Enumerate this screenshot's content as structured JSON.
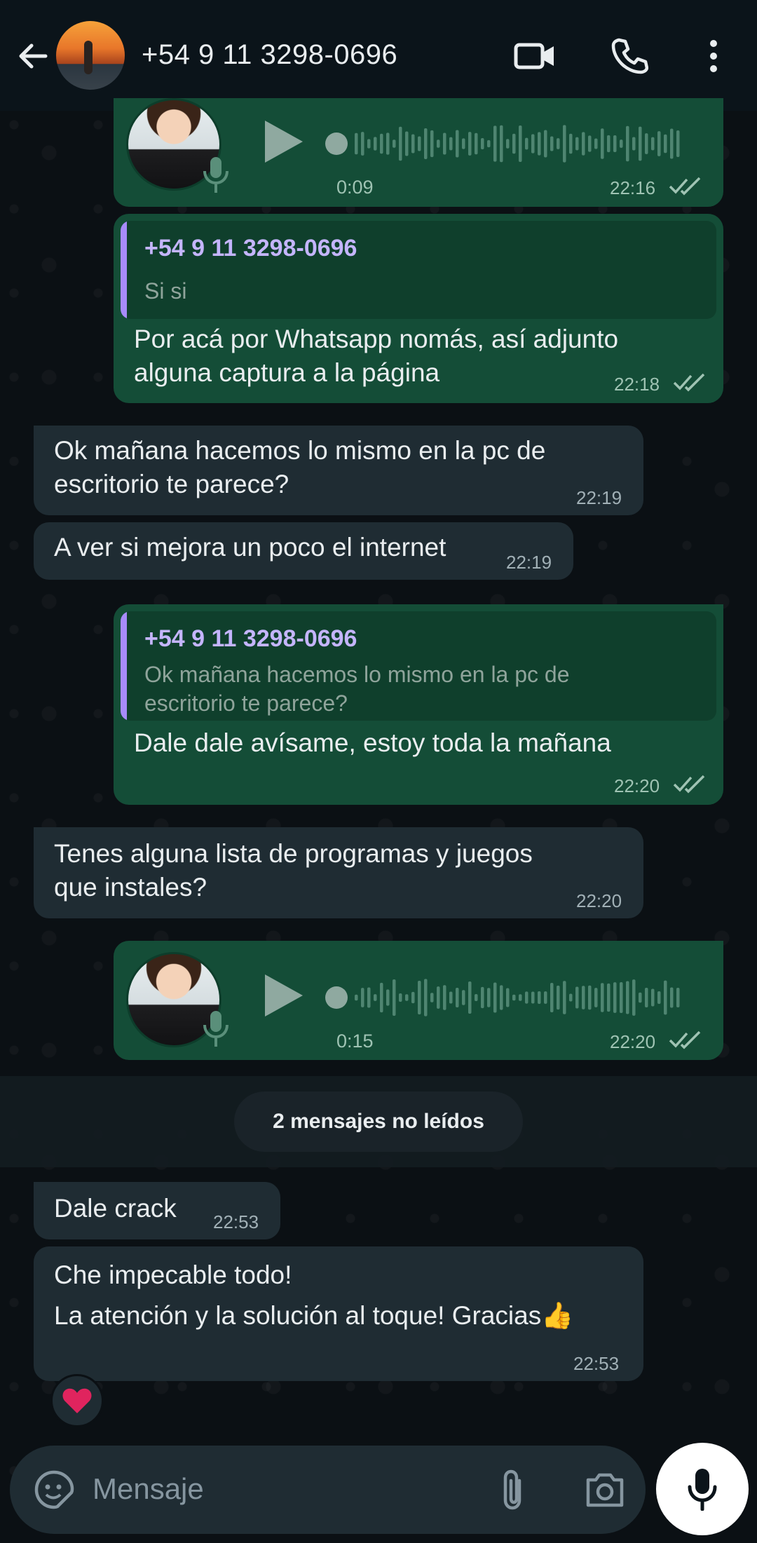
{
  "header": {
    "contact_name": "+54 9 11 3298-0696",
    "icons": [
      "back-arrow-icon",
      "video-call-icon",
      "phone-icon",
      "more-options-icon"
    ]
  },
  "messages": [
    {
      "type": "voice",
      "direction": "out",
      "duration": "0:09",
      "time": "22:16",
      "status": "read"
    },
    {
      "type": "text",
      "direction": "out",
      "quote_author": "+54 9 11 3298-0696",
      "quote_text": "Si si",
      "text": "Por acá por Whatsapp nomás, así adjunto\nalguna captura a la página",
      "time": "22:18",
      "status": "read"
    },
    {
      "type": "text",
      "direction": "in",
      "text": "Ok mañana hacemos lo mismo en la pc de\nescritorio te parece?",
      "time": "22:19"
    },
    {
      "type": "text",
      "direction": "in",
      "text": "A ver si mejora un poco el internet",
      "time": "22:19"
    },
    {
      "type": "text",
      "direction": "out",
      "quote_author": "+54 9 11 3298-0696",
      "quote_text": "Ok mañana hacemos lo mismo en la pc de\nescritorio te parece?",
      "text": "Dale dale avísame, estoy toda la mañana",
      "time": "22:20",
      "status": "read"
    },
    {
      "type": "text",
      "direction": "in",
      "text": "Tenes alguna lista de programas y juegos\nque instales?",
      "time": "22:20"
    },
    {
      "type": "voice",
      "direction": "out",
      "duration": "0:15",
      "time": "22:20",
      "status": "read"
    },
    {
      "type": "text",
      "direction": "in",
      "text": "Dale crack",
      "time": "22:53"
    },
    {
      "type": "text",
      "direction": "in",
      "text": "Che impecable todo!\nLa atención y la solución al toque! Gracias👍",
      "time": "22:53",
      "reaction": "❤️"
    }
  ],
  "unread_banner": "2 mensajes no leídos",
  "composer": {
    "placeholder": "Mensaje",
    "icons": [
      "sticker-icon",
      "attach-icon",
      "camera-icon",
      "mic-icon"
    ]
  },
  "colors": {
    "outgoing_bubble": "#144d37",
    "incoming_bubble": "#1f2c33",
    "quote_bar": "#a78bfa",
    "background": "#0b1014"
  }
}
